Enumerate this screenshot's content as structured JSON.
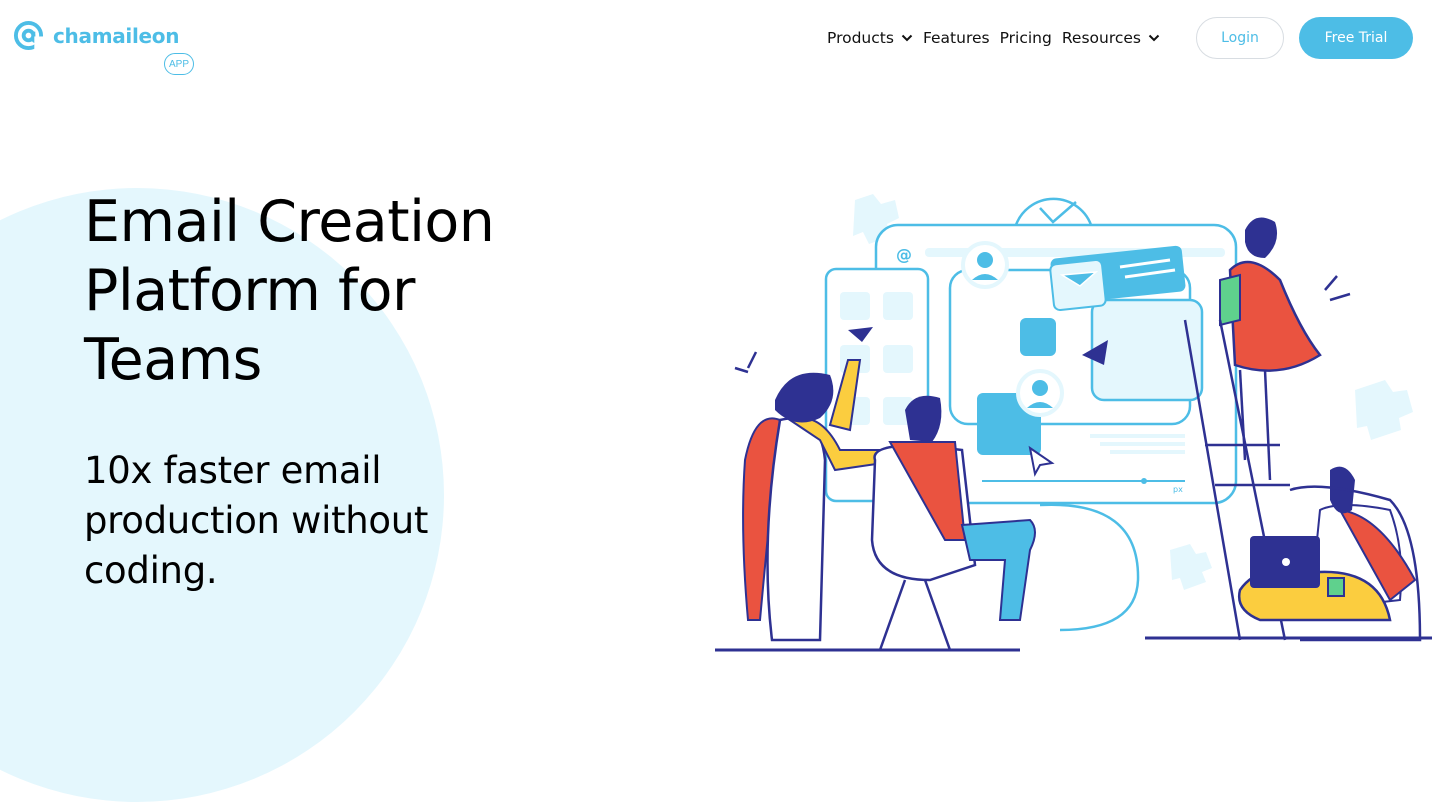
{
  "brand": {
    "name": "chamaileon",
    "badge": "APP",
    "color": "#4dbde6"
  },
  "nav": {
    "items": [
      {
        "label": "Products",
        "has_dropdown": true
      },
      {
        "label": "Features",
        "has_dropdown": false
      },
      {
        "label": "Pricing",
        "has_dropdown": false
      },
      {
        "label": "Resources",
        "has_dropdown": true
      }
    ],
    "login_label": "Login",
    "trial_label": "Free Trial"
  },
  "hero": {
    "title": "Email Creation Platform for Teams",
    "subtitle": "10x faster email production without coding."
  },
  "illustration": {
    "description": "team-collaborating-on-email-builder",
    "unit_label": "px",
    "colors": {
      "primary_blue": "#4dbde6",
      "light_blue": "#e4f7fd",
      "navy": "#2e3192",
      "red": "#ea5340",
      "yellow": "#fbcd3f",
      "green": "#5fd18d"
    }
  }
}
